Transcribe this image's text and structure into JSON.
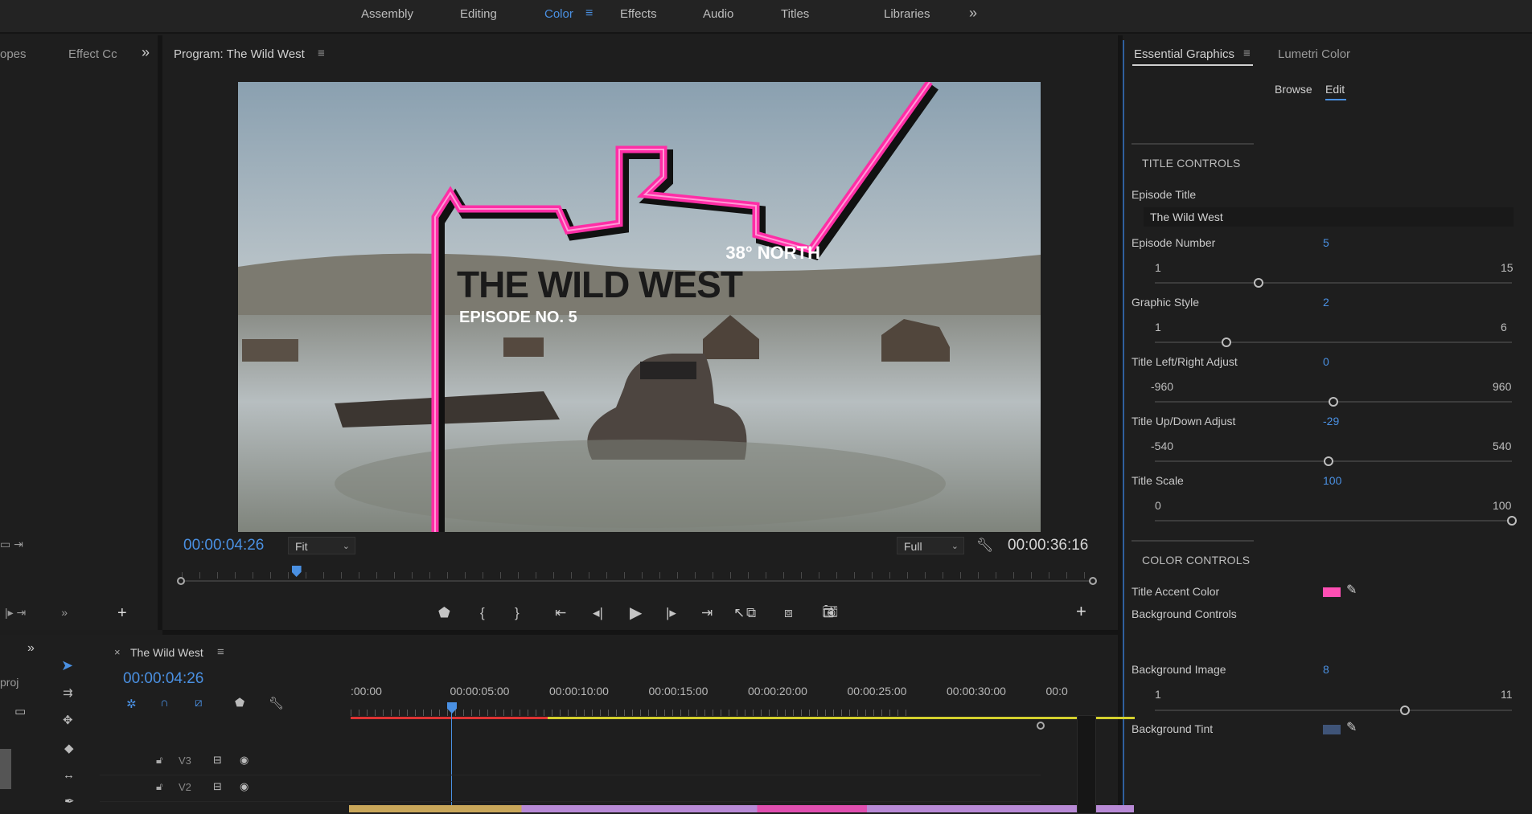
{
  "workspaces": {
    "tabs": [
      {
        "label": "Assembly"
      },
      {
        "label": "Editing"
      },
      {
        "label": "Color",
        "active": true
      },
      {
        "label": "Effects"
      },
      {
        "label": "Audio"
      },
      {
        "label": "Titles"
      },
      {
        "label": "Libraries"
      }
    ],
    "overflow_icon": "double-chevron-right-icon",
    "menu_icon": "hamburger-menu-icon"
  },
  "left_panel": {
    "tabs": [
      "opes",
      "Effect Cc"
    ],
    "overflow_icon": "double-chevron-right-icon"
  },
  "program_monitor": {
    "title": "Program: The Wild West",
    "current_timecode": "00:00:04:26",
    "duration_timecode": "00:00:36:16",
    "zoom": "Fit",
    "resolution": "Full",
    "playhead_fraction": 0.126,
    "graphic": {
      "north": "38° NORTH",
      "title": "THE WILD WEST",
      "episode": "EPISODE NO. 5",
      "accent": "#ff2ea6"
    },
    "controls": [
      "marker-icon",
      "mark-in-icon",
      "mark-out-icon",
      "go-to-in-icon",
      "step-back-icon",
      "play-icon",
      "step-forward-icon",
      "go-to-out-icon",
      "insert-icon",
      "overwrite-icon",
      "lift-icon",
      "camera-icon"
    ]
  },
  "essential_graphics": {
    "tabs": [
      {
        "label": "Essential Graphics",
        "active": true
      },
      {
        "label": "Lumetri Color"
      }
    ],
    "subtabs": [
      {
        "label": "Browse"
      },
      {
        "label": "Edit",
        "active": true
      }
    ],
    "title_controls": {
      "heading": "TITLE CONTROLS",
      "episode_title_label": "Episode Title",
      "episode_title_value": "The Wild West",
      "sliders": [
        {
          "label": "Episode Number",
          "value": "5",
          "min": "1",
          "max": "15",
          "fraction": 0.29
        },
        {
          "label": "Graphic Style",
          "value": "2",
          "min": "1",
          "max": "6",
          "fraction": 0.2
        },
        {
          "label": "Title Left/Right Adjust",
          "value": "0",
          "min": "-960",
          "max": "960",
          "fraction": 0.5
        },
        {
          "label": "Title Up/Down Adjust",
          "value": "-29",
          "min": "-540",
          "max": "540",
          "fraction": 0.487
        },
        {
          "label": "Title Scale",
          "value": "100",
          "min": "0",
          "max": "100",
          "fraction": 1.0
        }
      ]
    },
    "color_controls": {
      "heading": "COLOR CONTROLS",
      "accent_label": "Title Accent Color",
      "accent_color": "#ff4fb4",
      "bg_controls_label": "Background Controls",
      "bg_image": {
        "label": "Background Image",
        "value": "8",
        "min": "1",
        "max": "11",
        "fraction": 0.7
      },
      "bg_tint_label": "Background Tint",
      "bg_tint_color": "#3f5478"
    }
  },
  "timeline": {
    "sequence_name": "The Wild West",
    "timecode": "00:00:04:26",
    "ruler": [
      ":00:00",
      "00:00:05:00",
      "00:00:10:00",
      "00:00:15:00",
      "00:00:20:00",
      "00:00:25:00",
      "00:00:30:00",
      "00:0"
    ],
    "tracks": [
      {
        "name": "V3"
      },
      {
        "name": "V2"
      }
    ],
    "project_label": "proj"
  }
}
